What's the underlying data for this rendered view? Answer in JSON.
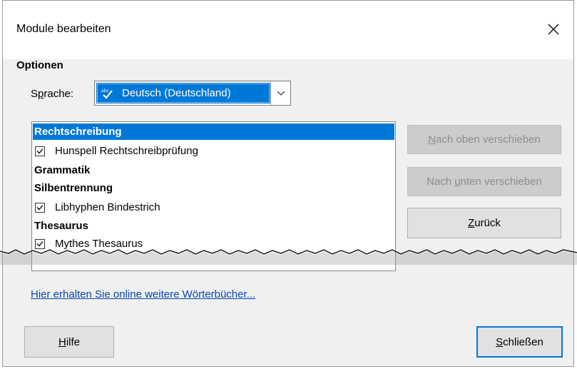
{
  "window": {
    "title": "Module bearbeiten",
    "close_icon": "close-icon"
  },
  "options": {
    "header": "Optionen",
    "language_label_prefix": "S",
    "language_label_accel": "p",
    "language_label_rest": "rache:",
    "language_value": "Deutsch (Deutschland)",
    "language_icon": "spellcheck-icon"
  },
  "modules": [
    {
      "type": "category",
      "label": "Rechtschreibung",
      "selected": true
    },
    {
      "type": "module",
      "label": "Hunspell Rechtschreibprüfung",
      "checked": true
    },
    {
      "type": "category",
      "label": "Grammatik",
      "selected": false
    },
    {
      "type": "category",
      "label": "Silbentrennung",
      "selected": false
    },
    {
      "type": "module",
      "label": "Libhyphen Bindestrich",
      "checked": true
    },
    {
      "type": "category",
      "label": "Thesaurus",
      "selected": false
    },
    {
      "type": "module",
      "label": "Mythes Thesaurus",
      "checked": true
    }
  ],
  "buttons": {
    "move_up": {
      "accel": "N",
      "rest": "ach oben verschieben",
      "enabled": false
    },
    "move_down": {
      "pre": "Nach ",
      "accel": "u",
      "rest": "nten verschieben",
      "enabled": false
    },
    "back": {
      "accel": "Z",
      "rest": "urück",
      "enabled": true
    },
    "help": {
      "accel": "H",
      "rest": "ilfe"
    },
    "close": {
      "accel": "S",
      "rest": "chließen"
    }
  },
  "link": {
    "text": "Hier erhalten Sie online weitere Wörterbücher..."
  },
  "colors": {
    "selection": "#0078d7",
    "dialog_bg": "#f0f0f0",
    "disabled_text": "#8d8d8d",
    "link": "#0645ad"
  }
}
